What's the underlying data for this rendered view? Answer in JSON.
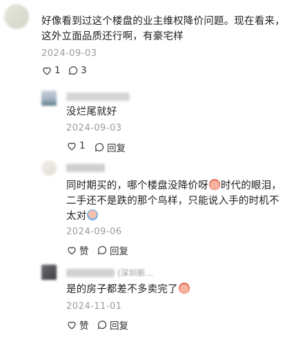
{
  "comments": [
    {
      "text_lines": [
        "好像看到过这个楼盘的业主维权降价问题。现在看来，",
        "这外立面品质还行啊，有豪宅样"
      ],
      "date": "2024-09-03",
      "likes": "1",
      "replies": "3"
    }
  ],
  "replies": [
    {
      "text": "没烂尾就好",
      "date": "2024-09-03",
      "likes": "1",
      "reply_label": "回复"
    },
    {
      "text_lines": [
        "同时期买的，哪个楼盘没降价呀",
        "时代的眼泪，",
        "二手还不是跌的那个鸟样，只能说入手的时机不",
        "太对"
      ],
      "date": "2024-09-06",
      "like_label": "赞",
      "reply_label": "回复"
    },
    {
      "name_visible": "(深圳新...",
      "text": "是的房子都差不多卖完了",
      "date": "2024-11-01",
      "like_label": "赞",
      "reply_label": "回复"
    }
  ],
  "colors": {
    "emoji_face": "#f2a48f",
    "emoji_accent": "#e66b5a",
    "date": "#9a9a9a"
  },
  "icons": [
    "heart-icon",
    "comment-bubble-icon",
    "crying-emoji",
    "shrug-emoji"
  ]
}
